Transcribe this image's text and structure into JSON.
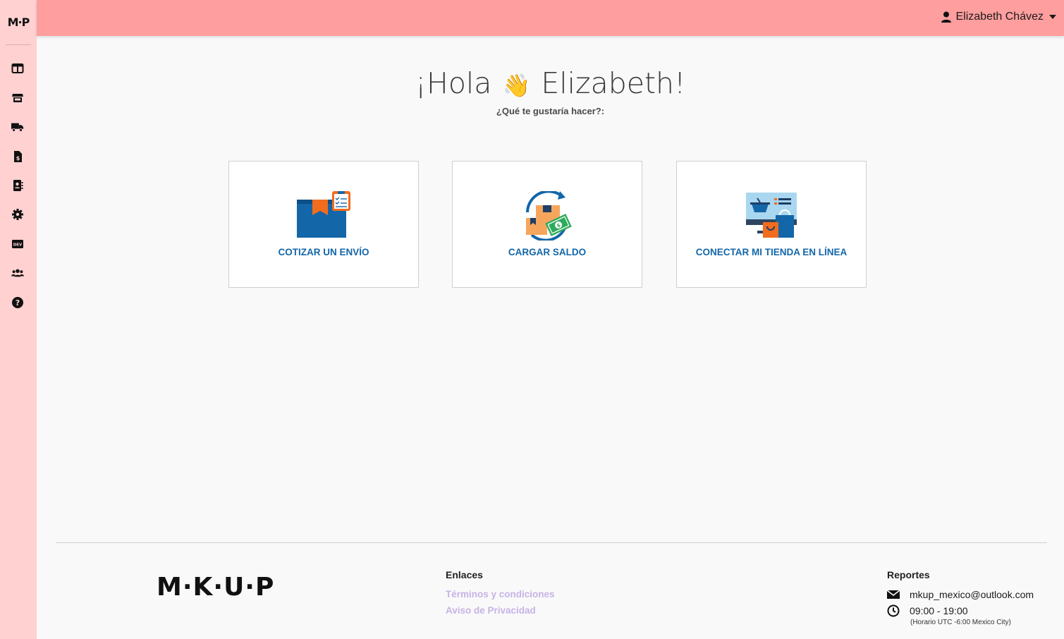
{
  "sidebar": {
    "logo": "M·P",
    "items": [
      {
        "name": "dashboard-icon"
      },
      {
        "name": "store-icon"
      },
      {
        "name": "truck-icon"
      },
      {
        "name": "invoice-icon"
      },
      {
        "name": "address-book-icon"
      },
      {
        "name": "gear-icon"
      },
      {
        "name": "dev-icon"
      },
      {
        "name": "users-icon"
      },
      {
        "name": "help-icon"
      }
    ]
  },
  "topbar": {
    "user_name": "Elizabeth Chávez"
  },
  "greeting": {
    "prefix": "¡Hola",
    "wave": "👋",
    "name": "Elizabeth!",
    "subtitle": "¿Qué te gustaría hacer?:"
  },
  "cards": [
    {
      "label": "COTIZAR UN ENVÍO",
      "icon": "box-clipboard-icon"
    },
    {
      "label": "CARGAR SALDO",
      "icon": "reload-money-icon"
    },
    {
      "label": "CONECTAR MI TIENDA EN LÍNEA",
      "icon": "online-store-icon"
    }
  ],
  "footer": {
    "logo": "M·K·U·P",
    "links_title": "Enlaces",
    "links": [
      "Términos y condiciones",
      "Aviso de Privacidad"
    ],
    "reports_title": "Reportes",
    "email": "mkup_mexico@outlook.com",
    "hours": "09:00 - 19:00",
    "timezone_note": "(Horario UTC -6:00 Mexico City)"
  },
  "colors": {
    "sidebar_bg": "#ffd1d1",
    "topbar_bg": "#ff9e9e",
    "card_label": "#1366a8",
    "link": "#c6b3e6"
  }
}
